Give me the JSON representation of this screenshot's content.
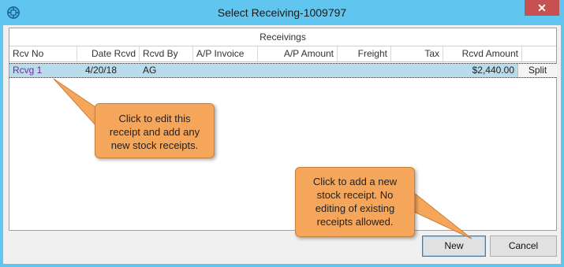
{
  "window": {
    "title": "Select Receiving-1009797",
    "close_label": "✕"
  },
  "grid": {
    "group_header": "Receivings",
    "columns": [
      "Rcv No",
      "Date Rcvd",
      "Rcvd By",
      "A/P Invoice",
      "A/P Amount",
      "Freight",
      "Tax",
      "Rcvd Amount"
    ],
    "rows": [
      {
        "rcv_no": "Rcvg 1",
        "date_rcvd": "4/20/18",
        "rcvd_by": "AG",
        "ap_invoice": "",
        "ap_amount": "",
        "freight": "",
        "tax": "",
        "rcvd_amount": "$2,440.00",
        "action": "Split"
      }
    ]
  },
  "callouts": {
    "edit_note": "Click to edit this receipt and add any new stock receipts.",
    "new_note": "Click to add a new stock receipt. No editing of existing receipts allowed."
  },
  "buttons": {
    "new_label": "New",
    "cancel_label": "Cancel"
  },
  "colors": {
    "title_bar": "#60c6f0",
    "close_button": "#c75050",
    "selected_row": "#b9dcec",
    "callout": "#f6a65a",
    "link": "#7a2a9a"
  }
}
